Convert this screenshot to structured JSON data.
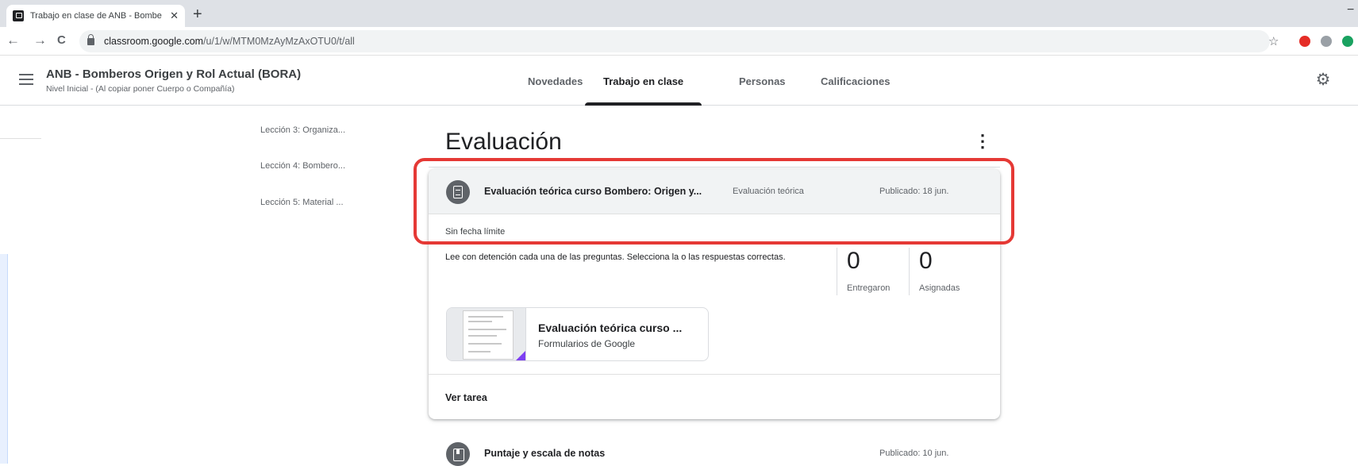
{
  "browser": {
    "tab_title": "Trabajo en clase de ANB - Bombe",
    "tab_close": "✕",
    "new_tab": "+",
    "minimize": "−",
    "url_host": "classroom.google.com",
    "url_path": "/u/1/w/MTM0MzAyMzAxOTU0/t/all",
    "back": "←",
    "forward": "→",
    "reload": "C",
    "star": "☆",
    "extension_colors": [
      "#e52d27",
      "#9aa0a6",
      "#1aa260"
    ]
  },
  "header": {
    "class_title": "ANB - Bomberos Origen y Rol Actual (BORA)",
    "class_subtitle": "Nivel Inicial - (Al copiar poner Cuerpo o Compañía)",
    "tabs": [
      {
        "label": "Novedades"
      },
      {
        "label": "Trabajo en clase"
      },
      {
        "label": "Personas"
      },
      {
        "label": "Calificaciones"
      }
    ],
    "active_tab": "Trabajo en clase"
  },
  "topics": [
    {
      "label": "Lección 3: Organiza..."
    },
    {
      "label": "Lección 4: Bombero..."
    },
    {
      "label": "Lección 5: Material ..."
    }
  ],
  "section": {
    "title": "Evaluación",
    "more": "⋮"
  },
  "assignment": {
    "title": "Evaluación teórica curso Bombero: Origen y...",
    "topic": "Evaluación teórica",
    "published": "Publicado: 18 jun.",
    "due": "Sin fecha límite",
    "description": "Lee con detención cada una de las preguntas. Selecciona la o las respuestas correctas.",
    "stats": [
      {
        "value": "0",
        "label": "Entregaron"
      },
      {
        "value": "0",
        "label": "Asignadas"
      }
    ],
    "attachment": {
      "title": "Evaluación teórica curso ...",
      "subtitle": "Formularios de Google",
      "accent": "#7e3ff2"
    },
    "view_link": "Ver tarea"
  },
  "next_item": {
    "title": "Puntaje y escala de notas",
    "published": "Publicado: 10 jun."
  },
  "highlight_color": "#e53935"
}
